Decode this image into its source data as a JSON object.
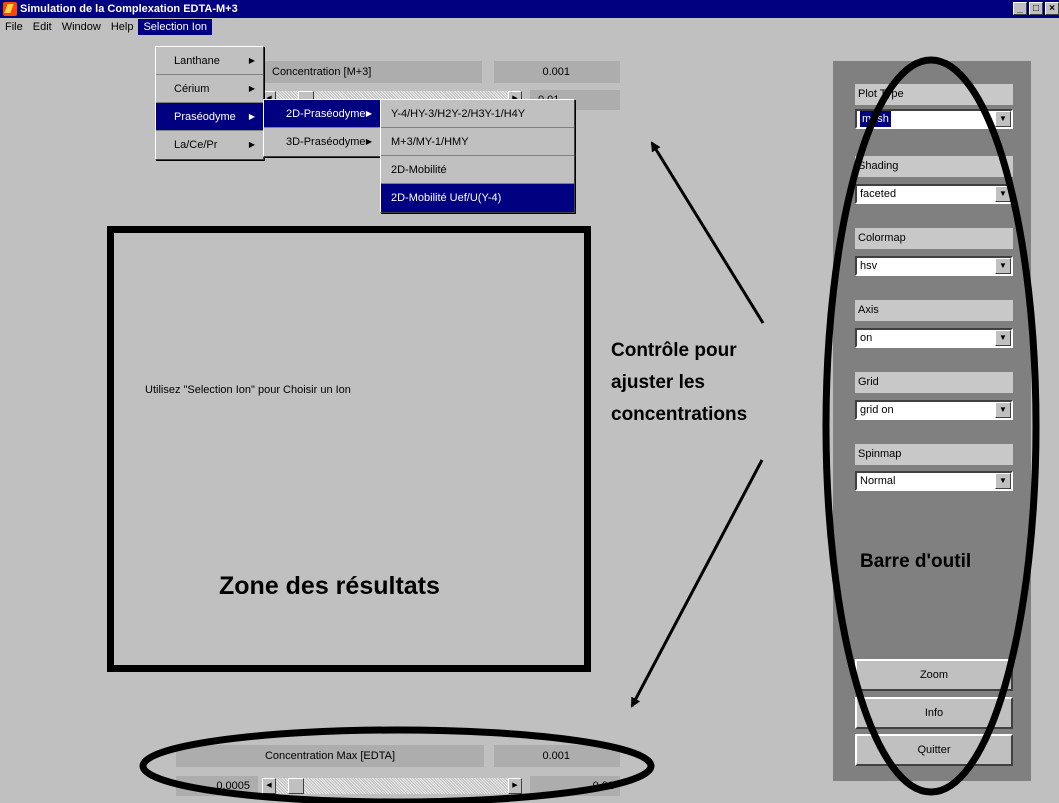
{
  "window": {
    "title": "Simulation de la Complexation EDTA-M+3",
    "controls": [
      "_",
      "□",
      "×"
    ]
  },
  "menubar": {
    "file": "File",
    "edit": "Edit",
    "window": "Window",
    "help": "Help",
    "selection_ion": "Selection Ion"
  },
  "menu_level1": {
    "items": [
      {
        "label": "Lanthane"
      },
      {
        "label": "Cérium"
      },
      {
        "label": "Praséodyme"
      },
      {
        "label": "La/Ce/Pr"
      }
    ],
    "selected_index": 2
  },
  "menu_level2": {
    "items": [
      {
        "label": "2D-Praséodyme"
      },
      {
        "label": "3D-Praséodyme"
      }
    ],
    "selected_index": 0
  },
  "menu_level3": {
    "items": [
      {
        "label": "Y-4/HY-3/H2Y-2/H3Y-1/H4Y"
      },
      {
        "label": "M+3/MY-1/HMY"
      },
      {
        "label": "2D-Mobilité"
      },
      {
        "label": "2D-Mobilité Uef/U(Y-4)"
      }
    ],
    "selected_index": 3
  },
  "top_control": {
    "label": "Concentration  [M+3]",
    "value": "0.001",
    "slider_max": "0.01"
  },
  "bottom_control": {
    "label": "Concentration Max [EDTA]",
    "value": "0.001",
    "slider_min": "0.0005",
    "slider_max": "0.01"
  },
  "result_area": {
    "hint": "Utilisez \"Selection Ion\" pour Choisir un Ion"
  },
  "toolbar": {
    "plot_type": {
      "label": "Plot Type",
      "value": "mesh"
    },
    "shading": {
      "label": "Shading",
      "value": "faceted"
    },
    "colormap": {
      "label": "Colormap",
      "value": "hsv"
    },
    "axis": {
      "label": "Axis",
      "value": "on"
    },
    "grid": {
      "label": "Grid",
      "value": "grid on"
    },
    "spinmap": {
      "label": "Spinmap",
      "value": "Normal"
    },
    "zoom": "Zoom",
    "info": "Info",
    "quitter": "Quitter"
  },
  "annotations": {
    "results_zone": "Zone des résultats",
    "control_line1": "Contrôle pour",
    "control_line2": "ajuster les",
    "control_line3": "concentrations",
    "toolbar_caption": "Barre d'outil"
  }
}
